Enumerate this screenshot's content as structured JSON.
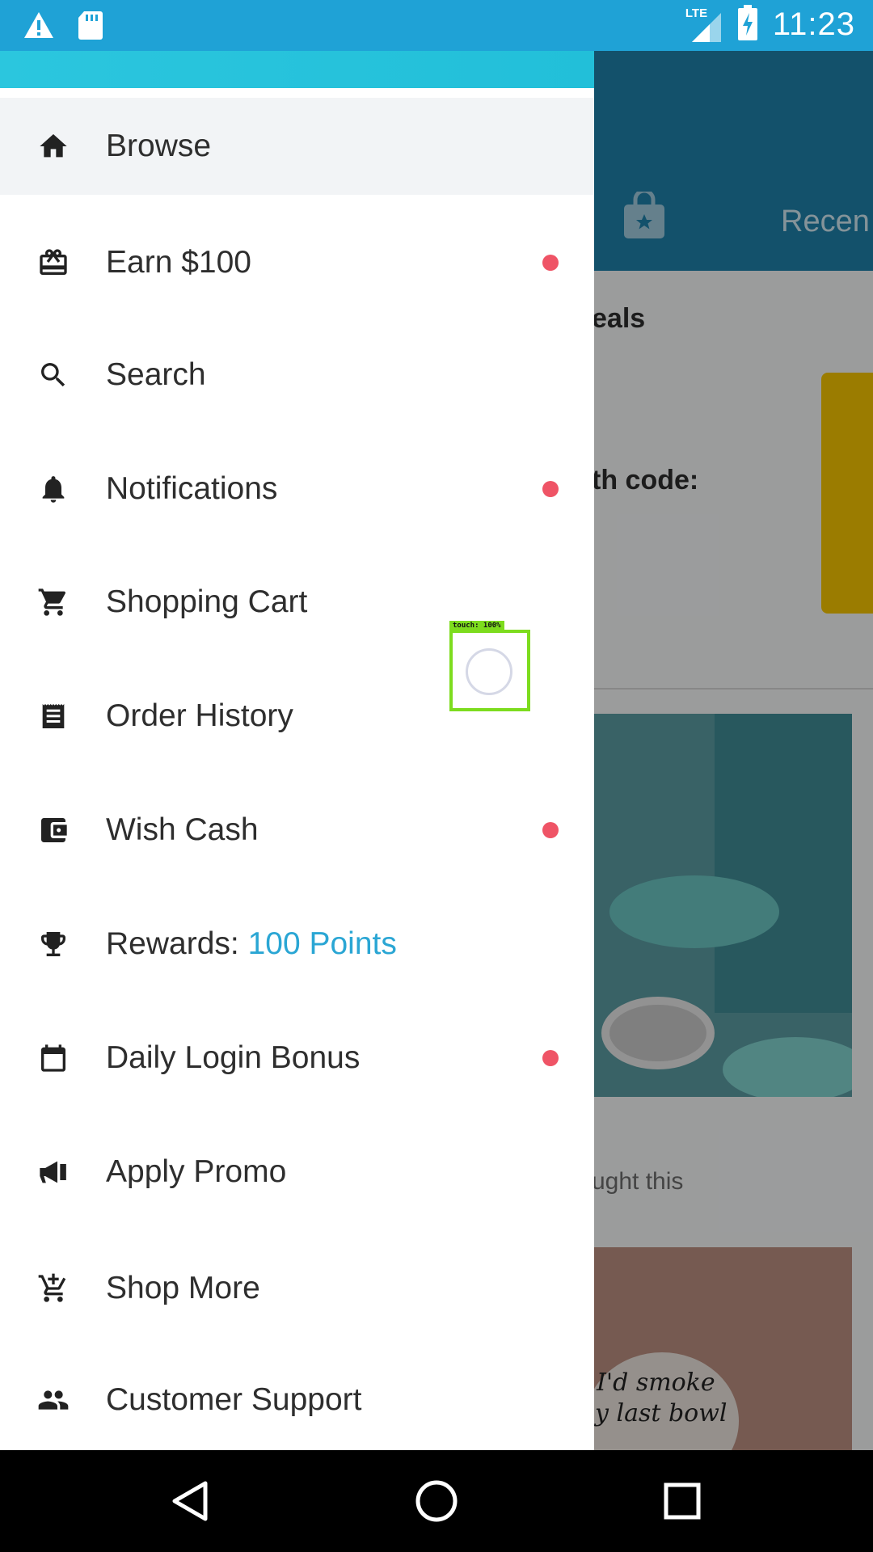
{
  "status_bar": {
    "time": "11:23",
    "network": "LTE",
    "icons": [
      "warning-icon",
      "sd-card-icon",
      "signal-icon",
      "battery-charging-icon"
    ]
  },
  "background": {
    "tab_label": "Recen",
    "section_title": "eals",
    "promo_text": "th code:",
    "caption": "ught this",
    "product_text_line1": "I'd smoke",
    "product_text_line2": "y last bowl"
  },
  "drawer": {
    "items": [
      {
        "label": "Browse",
        "icon": "home-icon",
        "dot": false,
        "selected": true
      },
      {
        "label": "Earn $100",
        "icon": "gift-icon",
        "dot": true
      },
      {
        "label": "Search",
        "icon": "search-icon",
        "dot": false
      },
      {
        "label": "Notifications",
        "icon": "bell-icon",
        "dot": true
      },
      {
        "label": "Shopping Cart",
        "icon": "cart-icon",
        "dot": false
      },
      {
        "label": "Order History",
        "icon": "receipt-icon",
        "dot": false
      },
      {
        "label": "Wish Cash",
        "icon": "wallet-icon",
        "dot": true
      },
      {
        "label": "Rewards: ",
        "points": "100 Points",
        "icon": "trophy-icon",
        "dot": false
      },
      {
        "label": "Daily Login Bonus",
        "icon": "calendar-icon",
        "dot": true
      },
      {
        "label": "Apply Promo",
        "icon": "megaphone-icon",
        "dot": false
      },
      {
        "label": "Shop More",
        "icon": "cart-plus-icon",
        "dot": false
      },
      {
        "label": "Customer Support",
        "icon": "people-icon",
        "dot": false
      }
    ],
    "notification_dot_color": "#ef5466",
    "accent_color": "#2aa6d4"
  },
  "touch_indicator": {
    "label": "touch: 100%"
  },
  "nav_bar": {
    "buttons": [
      "back-icon",
      "home-circle-icon",
      "recents-icon"
    ]
  }
}
